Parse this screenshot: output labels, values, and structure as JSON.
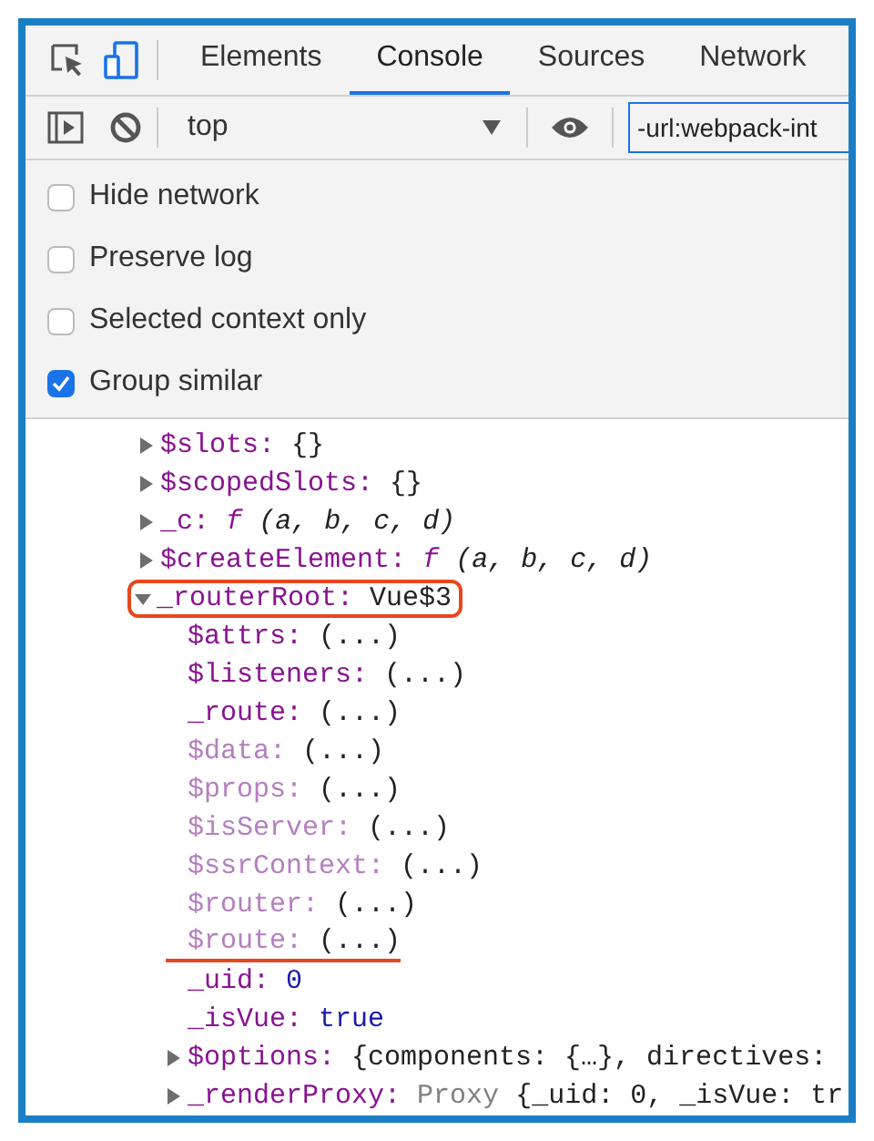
{
  "tabs": [
    {
      "label": "Elements",
      "selected": false
    },
    {
      "label": "Console",
      "selected": true
    },
    {
      "label": "Sources",
      "selected": false
    },
    {
      "label": "Network",
      "selected": false
    }
  ],
  "toolbar": {
    "context": "top",
    "filter": "-url:webpack-int"
  },
  "settings": [
    {
      "label": "Hide network",
      "checked": false
    },
    {
      "label": "Preserve log",
      "checked": false
    },
    {
      "label": "Selected context only",
      "checked": false
    },
    {
      "label": "Group similar",
      "checked": true
    }
  ],
  "tree": [
    {
      "key": "$slots:",
      "expandable": true,
      "expanded": false,
      "dimmed": false,
      "value": [
        {
          "text": "{}",
          "kind": "plain"
        }
      ]
    },
    {
      "key": "$scopedSlots:",
      "expandable": true,
      "expanded": false,
      "dimmed": false,
      "value": [
        {
          "text": "{}",
          "kind": "plain"
        }
      ]
    },
    {
      "key": "_c:",
      "expandable": true,
      "expanded": false,
      "dimmed": false,
      "value": [
        {
          "text": "f",
          "kind": "function"
        },
        {
          "text": "(a, b, c, d)",
          "kind": "italic"
        }
      ]
    },
    {
      "key": "$createElement:",
      "expandable": true,
      "expanded": false,
      "dimmed": false,
      "value": [
        {
          "text": "f",
          "kind": "function"
        },
        {
          "text": "(a, b, c, d)",
          "kind": "italic"
        }
      ]
    },
    {
      "key": "_routerRoot:",
      "expandable": true,
      "expanded": true,
      "dimmed": false,
      "highlighted": true,
      "value": [
        {
          "text": "Vue$3",
          "kind": "plain"
        }
      ],
      "children": [
        {
          "key": "$attrs:",
          "dimmed": false,
          "value": [
            {
              "text": "(...)",
              "kind": "plain"
            }
          ]
        },
        {
          "key": "$listeners:",
          "dimmed": false,
          "value": [
            {
              "text": "(...)",
              "kind": "plain"
            }
          ]
        },
        {
          "key": "_route:",
          "dimmed": false,
          "value": [
            {
              "text": "(...)",
              "kind": "plain"
            }
          ]
        },
        {
          "key": "$data:",
          "dimmed": true,
          "value": [
            {
              "text": "(...)",
              "kind": "plain"
            }
          ]
        },
        {
          "key": "$props:",
          "dimmed": true,
          "value": [
            {
              "text": "(...)",
              "kind": "plain"
            }
          ]
        },
        {
          "key": "$isServer:",
          "dimmed": true,
          "value": [
            {
              "text": "(...)",
              "kind": "plain"
            }
          ]
        },
        {
          "key": "$ssrContext:",
          "dimmed": true,
          "value": [
            {
              "text": "(...)",
              "kind": "plain"
            }
          ]
        },
        {
          "key": "$router:",
          "dimmed": true,
          "value": [
            {
              "text": "(...)",
              "kind": "plain"
            }
          ]
        },
        {
          "key": "$route:",
          "dimmed": true,
          "underlined": true,
          "value": [
            {
              "text": "(...)",
              "kind": "plain"
            }
          ]
        },
        {
          "key": "_uid:",
          "dimmed": false,
          "value": [
            {
              "text": "0",
              "kind": "number"
            }
          ]
        },
        {
          "key": "_isVue:",
          "dimmed": false,
          "value": [
            {
              "text": "true",
              "kind": "number"
            }
          ]
        },
        {
          "key": "$options:",
          "expandable": true,
          "expanded": false,
          "dimmed": false,
          "value": [
            {
              "text": "{components: {…}, directives:",
              "kind": "plain"
            }
          ]
        },
        {
          "key": "_renderProxy:",
          "expandable": true,
          "expanded": false,
          "dimmed": false,
          "value": [
            {
              "text": "Proxy",
              "kind": "undefined"
            },
            {
              "text": "{_uid: 0, _isVue: tr",
              "kind": "plain"
            }
          ]
        }
      ]
    }
  ]
}
